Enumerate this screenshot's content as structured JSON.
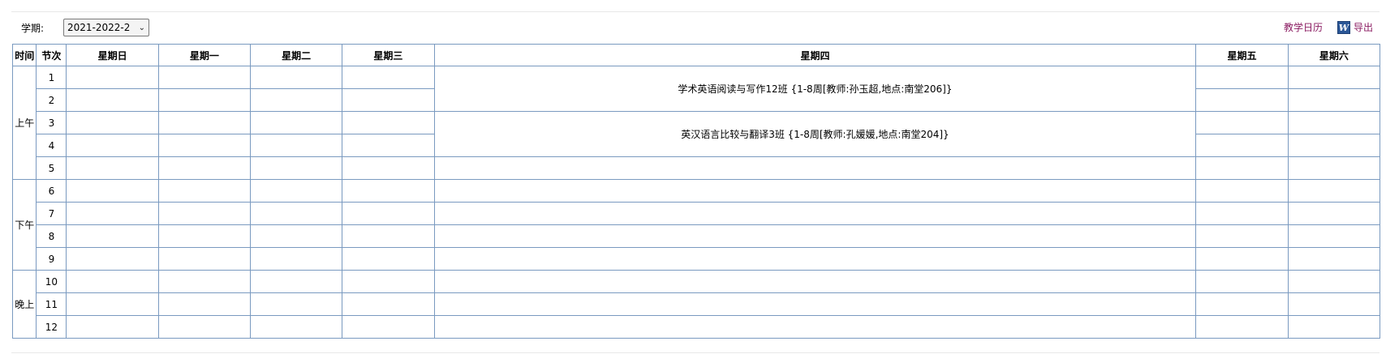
{
  "term": {
    "label": "学期:",
    "value": "2021-2022-2"
  },
  "links": {
    "calendar": "教学日历",
    "export": "导出",
    "export_icon": "word-icon"
  },
  "headers": [
    "时间",
    "节次",
    "星期日",
    "星期一",
    "星期二",
    "星期三",
    "星期四",
    "星期五",
    "星期六"
  ],
  "periods": [
    "上午",
    "下午",
    "晚上"
  ],
  "sections": [
    "1",
    "2",
    "3",
    "4",
    "5",
    "6",
    "7",
    "8",
    "9",
    "10",
    "11",
    "12"
  ],
  "courses": [
    {
      "text": "学术英语阅读与写作12班  {1-8周[教师:孙玉超,地点:南堂206]}"
    },
    {
      "text": "英汉语言比较与翻译3班  {1-8周[教师:孔媛媛,地点:南堂204]}"
    }
  ],
  "colors": {
    "grid": "#7a9ac0",
    "link": "#8b1c62"
  }
}
